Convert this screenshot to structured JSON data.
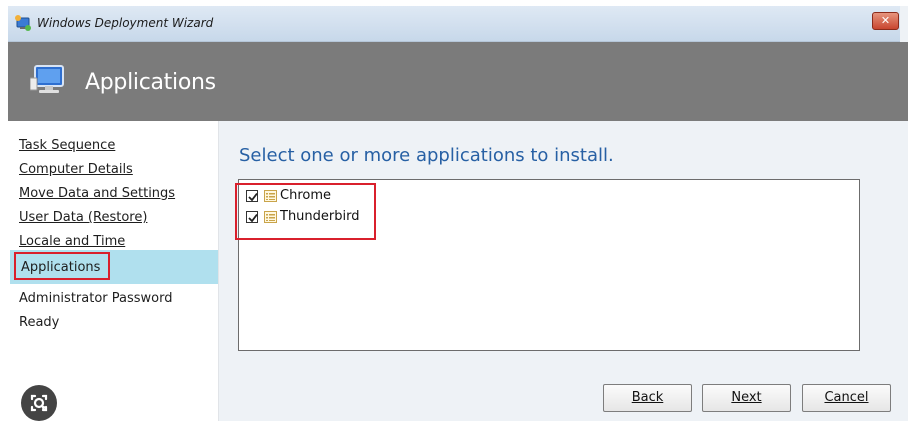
{
  "window": {
    "title": "Windows Deployment Wizard",
    "close_glyph": "✕"
  },
  "banner": {
    "title": "Applications",
    "icon": "monitor-icon"
  },
  "nav": {
    "items": [
      {
        "label": "Task Sequence",
        "state": "visited"
      },
      {
        "label": "Computer Details",
        "state": "visited"
      },
      {
        "label": "Move Data and Settings",
        "state": "visited"
      },
      {
        "label": "User Data (Restore)",
        "state": "visited"
      },
      {
        "label": "Locale and Time",
        "state": "visited"
      },
      {
        "label": "Applications",
        "state": "current"
      },
      {
        "label": "Administrator Password",
        "state": "pending"
      },
      {
        "label": "Ready",
        "state": "pending"
      }
    ]
  },
  "main": {
    "heading": "Select one or more applications to install.",
    "apps": [
      {
        "label": "Chrome",
        "checked": true
      },
      {
        "label": "Thunderbird",
        "checked": true
      }
    ]
  },
  "buttons": {
    "back": "Back",
    "next": "Next",
    "cancel": "Cancel"
  },
  "colors": {
    "highlight": "#d9202c",
    "selected_bg": "#b0e0ee",
    "heading": "#2760a4",
    "banner": "#7b7b7b"
  }
}
